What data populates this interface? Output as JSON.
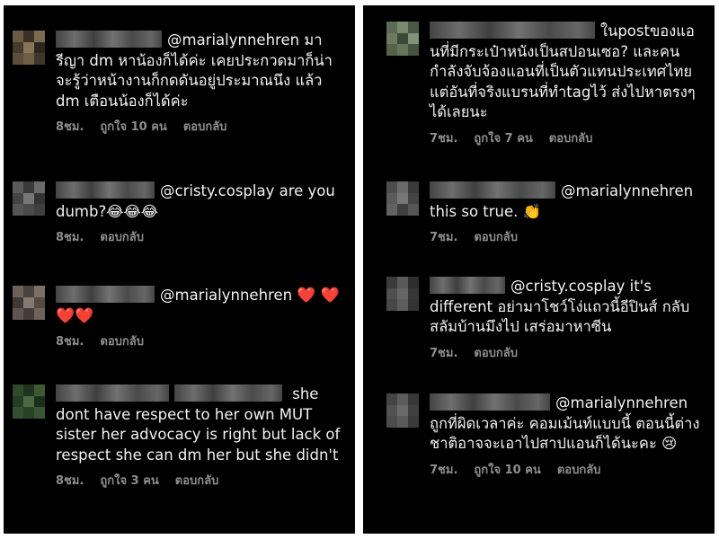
{
  "left_panel": {
    "comments": [
      {
        "mention": "@marialynnehren",
        "text": "มา รีญา dm หาน้องก็ได้ค่ะ เคยประกวดมาก็น่าจะรู้ว่าหน้างานก็กดดันอยู่ประมาณนึง แล้ว dm เตือนน้องก็ได้ค่ะ",
        "time": "8ชม.",
        "likes": "ถูกใจ 10 คน",
        "reply": "ตอบกลับ"
      },
      {
        "mention": "@cristy.cosplay",
        "text": "are you dumb?😂😂😂",
        "time": "8ชม.",
        "reply": "ตอบกลับ"
      },
      {
        "mention": "@marialynnehren",
        "text": "❤️ ❤️❤️❤️",
        "time": "8ชม.",
        "reply": "ตอบกลับ"
      },
      {
        "text": "she dont have respect to her own MUT sister her advocacy is right but lack of respect she can dm her but she didn't",
        "time": "8ชม.",
        "likes": "ถูกใจ 3 คน",
        "reply": "ตอบกลับ"
      }
    ]
  },
  "right_panel": {
    "comments": [
      {
        "text": "ในpostของแอนที่มีกระเป๋าหนังเป็นสปอนเซอ? และคนกำลังจับจ้องแอนที่เป็นตัวแทนประเทศไทย แต่อันที่จริงแบรนที่ทำtagไว้ ส่งไปหาตรงๆได้เลยนะ",
        "time": "7ชม.",
        "likes": "ถูกใจ 7 คน",
        "reply": "ตอบกลับ"
      },
      {
        "mention": "@marialynnehren",
        "text": "this so true. 👏",
        "time": "7ชม.",
        "reply": "ตอบกลับ"
      },
      {
        "mention": "@cristy.cosplay",
        "text": "it's different อย่ามาโชว์โง่แถวนี้อีปินส์ กลับสลัมบ้านมึงไป เสร่อมาหาซีน",
        "time": "7ชม.",
        "reply": "ตอบกลับ"
      },
      {
        "mention": "@marialynnehren",
        "text": "ถูกที่ผิดเวลาค่ะ คอมเม้นท์แบบนี้ ตอนนี้ต่างชาติอาจจะเอาไปสาปแอนก็ได้นะคะ 😢",
        "time": "7ชม.",
        "likes": "ถูกใจ 10 คน",
        "reply": "ตอบกลับ"
      }
    ]
  },
  "colors": {
    "background": "#000000",
    "text": "#f2f2f2",
    "meta": "#8e8e8e",
    "heart": "#ee1f35"
  }
}
